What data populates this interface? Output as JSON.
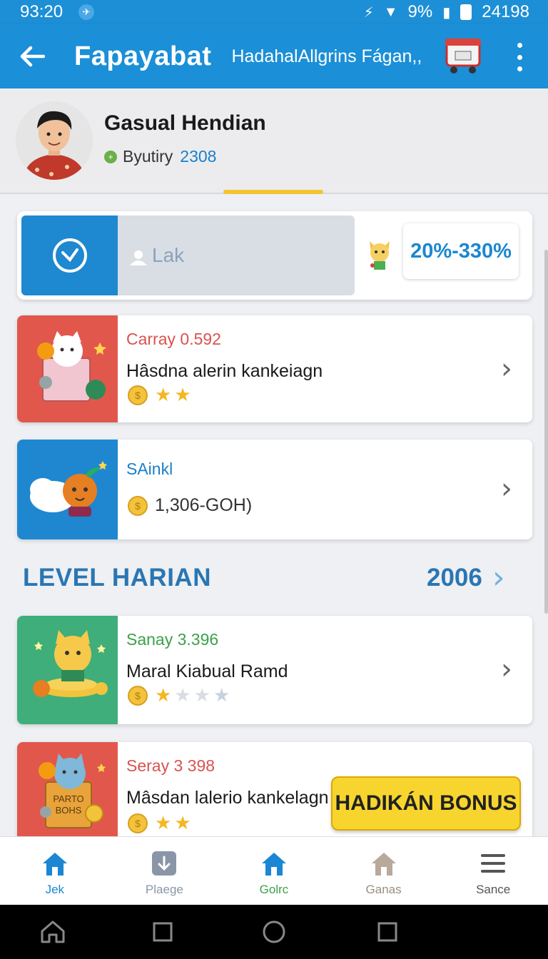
{
  "status_bar": {
    "time": "93:20",
    "battery_text": "9%",
    "clock_right": "24198"
  },
  "app_bar": {
    "title": "Fapayabat",
    "subtitle": "HadahalAllgrins Fágan,,",
    "back_icon": "back-arrow-icon",
    "menu_icon": "more-vert-icon"
  },
  "profile": {
    "name": "Gasual Hendian",
    "meta_label": "Byutiry",
    "meta_value": "2308"
  },
  "search": {
    "placeholder": "Lak",
    "range": "20%-330%"
  },
  "cards": [
    {
      "subtitle": "Carray 0.592",
      "title": "Hâsdna alerin kankeiagn",
      "stars": 2,
      "thumb_color": "#e2574c",
      "subtitle_color": "#d9534f"
    },
    {
      "subtitle": "SAinkl",
      "title": "1,306-GOH)",
      "stars": 0,
      "thumb_color": "#1f87d0",
      "subtitle_color": "#1b7fc9"
    }
  ],
  "section": {
    "title": "LEVEL HARIAN",
    "count": "2006"
  },
  "level_cards": [
    {
      "subtitle": "Sanay 3.396",
      "title": "Maral Kiabual Ramd",
      "stars": 1,
      "stars_total": 4,
      "thumb_color": "#3fae7a",
      "subtitle_color": "#3ba14a"
    },
    {
      "subtitle": "Seray 3 398",
      "title": "Mâsdan laleriο kankelagn",
      "stars": 2,
      "thumb_color": "#e2574c",
      "subtitle_color": "#d9534f",
      "button": "HADIKÁN BONUS",
      "box_text_1": "PARTO",
      "box_text_2": "BOHS"
    }
  ],
  "bottom_nav": [
    {
      "label": "Jek",
      "icon": "home-icon",
      "color": "#1b86d3"
    },
    {
      "label": "Plaege",
      "icon": "download-icon",
      "color": "#8a96a8"
    },
    {
      "label": "Golrc",
      "icon": "home-icon",
      "color": "#1b86d3",
      "label_color": "#3ba14a"
    },
    {
      "label": "Ganas",
      "icon": "home-icon",
      "color": "#b8a99a"
    },
    {
      "label": "Sance",
      "icon": "menu-icon",
      "color": "#555555"
    }
  ],
  "colors": {
    "primary": "#1b8fd7",
    "accent_yellow": "#f8d52e",
    "section_blue": "#2a76b3"
  }
}
